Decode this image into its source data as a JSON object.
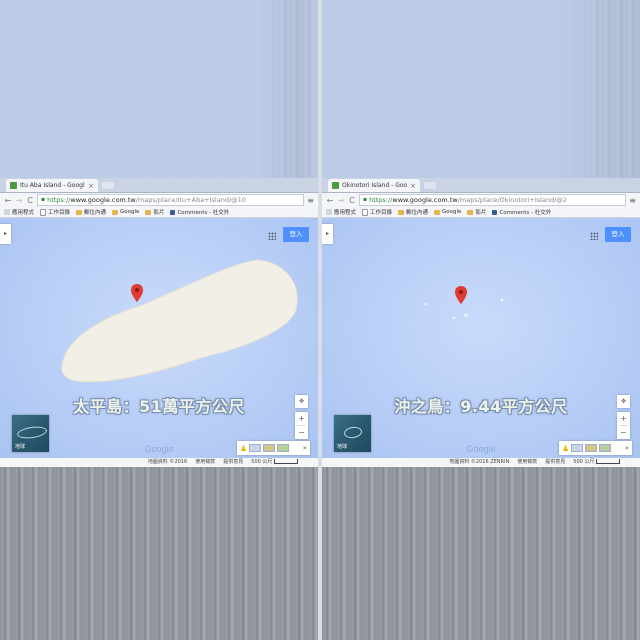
{
  "panels": [
    {
      "tab_title": "Itu Aba Island - Google",
      "tab_close": "×",
      "url_scheme": "https://",
      "url_host": "www.google.com.tw",
      "url_path": "/maps/place/Itu+Aba+Island/@10",
      "caption": "太平島：51萬平方公尺",
      "thumbnail_label": "地球",
      "attribution": [
        "地圖資料 ©2016",
        "使用條款",
        "提供意見",
        "500 公尺"
      ]
    },
    {
      "tab_title": "Okinotori Island - Goog",
      "tab_close": "×",
      "url_scheme": "https://",
      "url_host": "www.google.com.tw",
      "url_path": "/maps/place/Okinotori+Island/@2",
      "caption": "沖之鳥：9.44平方公尺",
      "thumbnail_label": "地球",
      "attribution": [
        "地圖資料 ©2016 ZENRIN",
        "使用條款",
        "提供意見",
        "500 公尺"
      ]
    }
  ],
  "bookmarks": [
    "應用程式",
    "工作目錄",
    "郵位內通",
    "Google",
    "影片",
    "Comments - 社交外"
  ],
  "signin_label": "登入",
  "google_logo": "Google",
  "nav": {
    "back": "←",
    "forward": "→",
    "reload": "C",
    "menu": "≡",
    "lock": "🔒"
  },
  "map_controls": {
    "compass": "✥",
    "zoom_in": "+",
    "zoom_out": "−",
    "side_arrow": "▸",
    "pegman": "♟",
    "expand": "»"
  },
  "colors": {
    "map_water": "#b7cdf6",
    "land": "#f2efe6",
    "marker": "#e03b30",
    "signin": "#4d90fe"
  }
}
